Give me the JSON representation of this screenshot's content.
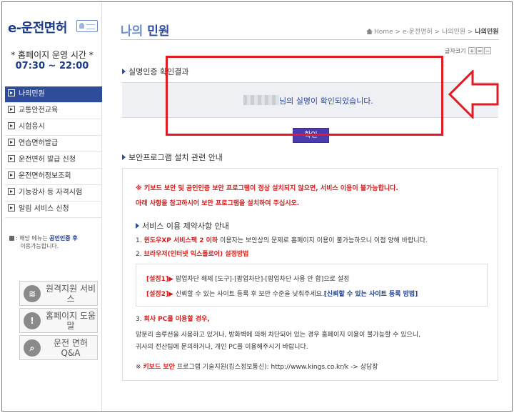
{
  "sidebar": {
    "logo": "e-운전면허",
    "hours_label": "* 홈페이지 운영 시간 *",
    "hours_value": "07:30 ~ 22:00",
    "menu": [
      {
        "label": "나의민원"
      },
      {
        "label": "교통안전교육"
      },
      {
        "label": "시험응시"
      },
      {
        "label": "연습면허발급"
      },
      {
        "label": "운전면허 발급 신청"
      },
      {
        "label": "운전면허정보조회"
      },
      {
        "label": "기능강사 등 자격시험"
      },
      {
        "label": "알림 서비스 신청"
      }
    ],
    "login_note": {
      "prefix": ": 해당 메뉴는 ",
      "link": "공인인증 후",
      "suffix": "이용가능합니다."
    },
    "quick_links": [
      {
        "label": "원격지원 서비스",
        "icon": "wifi-icon"
      },
      {
        "label": "홈페이지 도움말",
        "icon": "exclamation-icon"
      },
      {
        "label": "운전 면허 Q&A",
        "icon": "magnifier-icon"
      }
    ]
  },
  "header": {
    "title_a": "나의",
    "title_b": " 민원",
    "breadcrumb": [
      "Home",
      "e-운전면허",
      "나의민원",
      "나의민원"
    ],
    "fontsize_label": "글자크기",
    "fontsize_buttons": [
      "+",
      "=",
      "−"
    ]
  },
  "result": {
    "section_title": "실명인증 확인결과",
    "message": "님의 실명이 확인되었습니다.",
    "confirm_label": "확인"
  },
  "security": {
    "section_title": "보안프로그램 설치 관련 안내",
    "warn1": "※ 키보드 보안 및 공인인증 보안 프로그램이 정상 설치되지 않으면, 서비스 이용이 불가능합니다.",
    "warn2": "아래 사항을 참고하시어 보안 프로그램을 설치하여 주십시오.",
    "limit_title": "서비스 이용 제약사항 안내",
    "item1_num": "1. ",
    "item1_hl": "윈도우XP 서비스팩 2 이하",
    "item1_rest": " 이용자는 보안상의 문제로 홈페이지 이용이 불가능하오니 이점 양해 바랍니다.",
    "item2_num": "2. ",
    "item2_hl": "브라우저(인터넷 익스플로어) 설정방법",
    "set1_tag": "[설정1]▶",
    "set1_text": " 팝업차단 해제 [도구]-[팝업차단]-[팝업차단 사용 안 함]으로 설정",
    "set2_tag": "[설정2]▶",
    "set2_text": " 신뢰할 수 있는 사이트 등록 후 보안 수준을 낮춰주세요.",
    "set2_link": "[신뢰할 수 있는 사이트 등록 방법]",
    "item3_num": "3. ",
    "item3_hl": "회사 PC를 이용할 경우,",
    "desc1": "망분리 솔루션을 사용하고 있거나, 방화벽에 의해 차단되어 있는 경우 홈페이지 이용이 불가능할 수 있으니,",
    "desc2": "귀사의 전산팀에 문의하거나, 개인 PC를 이용해주시기 바랍니다.",
    "footer_prefix": "※ ",
    "footer_hl": "키보드 보안",
    "footer_rest": " 프로그램 기술지원(킹스정보통신): http://www.kings.co.kr/k -> 상담창"
  },
  "colors": {
    "brand": "#2e4c9a",
    "highlight": "#e01b24",
    "warning": "#d41b1b"
  }
}
